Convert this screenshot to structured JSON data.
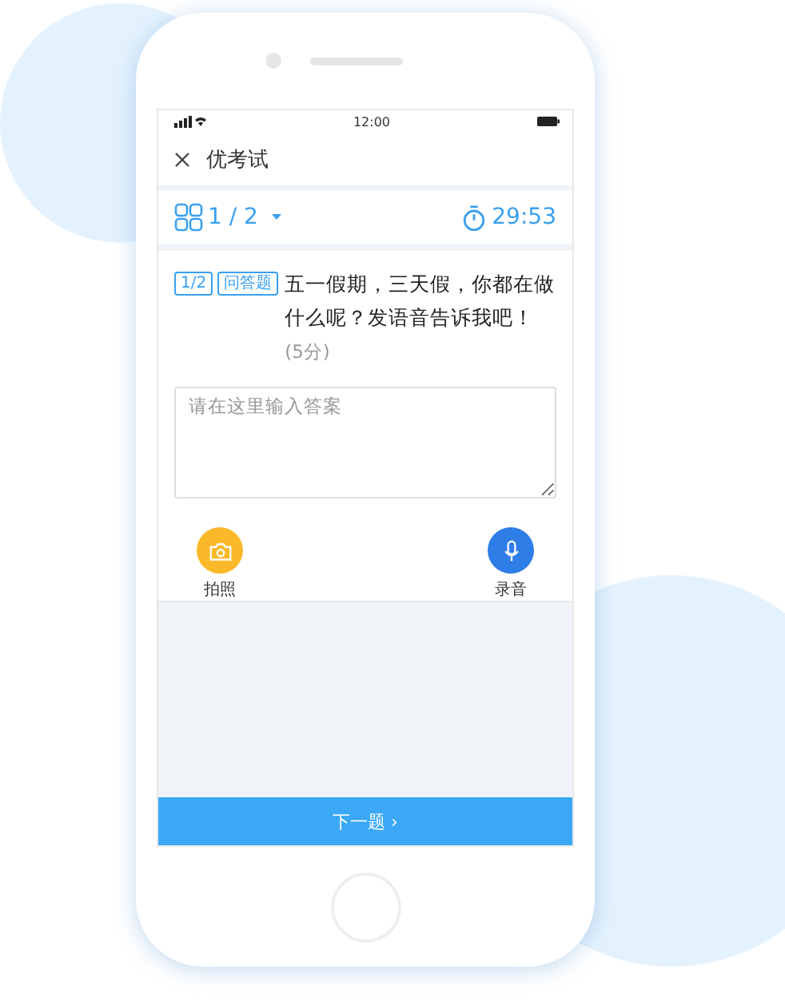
{
  "status_bar": {
    "time": "12:00"
  },
  "header": {
    "title": "优考试"
  },
  "nav": {
    "progress": "1 / 2",
    "timer": "29:53"
  },
  "question": {
    "number_tag": "1/2",
    "type_tag": "问答题",
    "text": "五一假期，三天假，你都在做什么呢？发语音告诉我吧！",
    "score": "(5分)"
  },
  "answer": {
    "placeholder": "请在这里输入答案"
  },
  "actions": [
    {
      "kind": "camera",
      "label": "拍照"
    },
    {
      "kind": "microphone",
      "label": "录音"
    }
  ],
  "next_button": {
    "label": "下一题 ›"
  }
}
